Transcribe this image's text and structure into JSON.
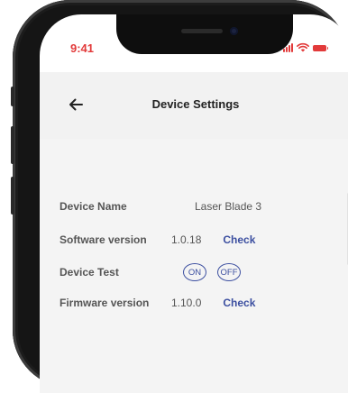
{
  "status_bar": {
    "time": "9:41"
  },
  "header": {
    "title": "Device Settings"
  },
  "settings": {
    "device_name": {
      "label": "Device Name",
      "value": "Laser Blade 3"
    },
    "software_version": {
      "label": "Software version",
      "value": "1.0.18",
      "action": "Check"
    },
    "device_test": {
      "label": "Device Test",
      "on_label": "ON",
      "off_label": "OFF"
    },
    "firmware_version": {
      "label": "Firmware version",
      "value": "1.10.0",
      "action": "Check"
    }
  },
  "colors": {
    "accent": "#3c4fa0",
    "status": "#e23a3a",
    "header_bg": "#f2f2f2"
  }
}
